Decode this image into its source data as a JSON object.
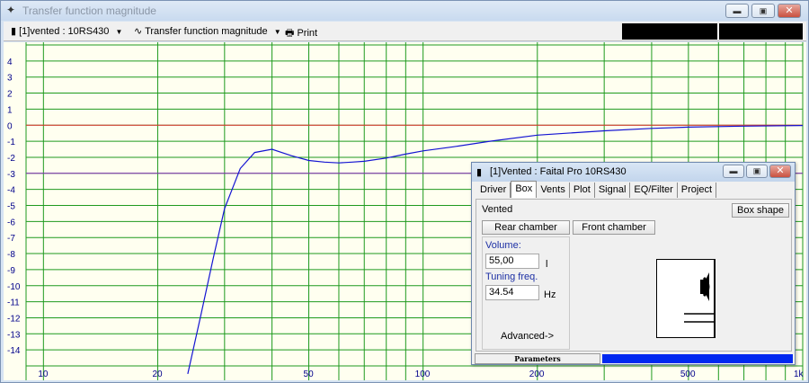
{
  "window": {
    "title": "Transfer function magnitude",
    "buttons": [
      "minimize",
      "maximize",
      "close"
    ]
  },
  "toolbar": {
    "project_select": "[1]vented : 10RS430",
    "view_select": "Transfer function magnitude",
    "print_label": "Print"
  },
  "chart_data": {
    "type": "line",
    "x_scale": "log",
    "xlim": [
      9,
      1000
    ],
    "ylim": [
      -15,
      5
    ],
    "x_ticks": [
      10,
      20,
      50,
      100,
      200,
      500,
      1000
    ],
    "x_tick_labels": [
      "10",
      "20",
      "50",
      "100",
      "200",
      "500",
      "1k"
    ],
    "y_ticks": [
      4,
      3,
      2,
      1,
      0,
      -1,
      -2,
      -3,
      -4,
      -5,
      -6,
      -7,
      -8,
      -9,
      -10,
      -11,
      -12,
      -13,
      -14
    ],
    "y_tick_labels": [
      "4",
      "3",
      "2",
      "1",
      "0",
      "-1",
      "-2",
      "-3",
      "-4",
      "-5",
      "-6",
      "-7",
      "-8",
      "-9",
      "-10",
      "-11",
      "-12",
      "-13",
      "-14"
    ],
    "grid": true,
    "reference_lines": [
      {
        "y": 0,
        "color": "#e83030"
      },
      {
        "y": -3,
        "color": "#8a2bbf"
      }
    ],
    "series": [
      {
        "color": "#1414d2",
        "x": [
          24,
          26,
          28,
          30,
          33,
          36,
          40,
          45,
          50,
          55,
          60,
          65,
          70,
          80,
          90,
          100,
          120,
          150,
          200,
          300,
          400,
          500,
          700,
          1000
        ],
        "y": [
          -15.5,
          -11.8,
          -8.3,
          -5.2,
          -2.7,
          -1.7,
          -1.5,
          -1.9,
          -2.2,
          -2.3,
          -2.35,
          -2.3,
          -2.25,
          -2.05,
          -1.8,
          -1.6,
          -1.35,
          -1.0,
          -0.62,
          -0.35,
          -0.2,
          -0.12,
          -0.06,
          -0.02
        ]
      }
    ]
  },
  "dialog": {
    "title": "[1]Vented : Faital Pro 10RS430",
    "tabs": [
      "Driver",
      "Box",
      "Vents",
      "Plot",
      "Signal",
      "EQ/Filter",
      "Project"
    ],
    "active_tab": "Box",
    "box_type": "Vented",
    "box_shape_button": "Box shape",
    "rear_chamber_button": "Rear chamber",
    "front_chamber_button": "Front chamber",
    "volume_label": "Volume:",
    "volume_value": "55,00",
    "volume_unit": "l",
    "tuning_label": "Tuning freq.",
    "tuning_value": "34.54",
    "tuning_unit": "Hz",
    "advanced_label": "Advanced->",
    "status_label": "Parameters",
    "progress": 1.0,
    "progress_color": "#0028f0"
  }
}
